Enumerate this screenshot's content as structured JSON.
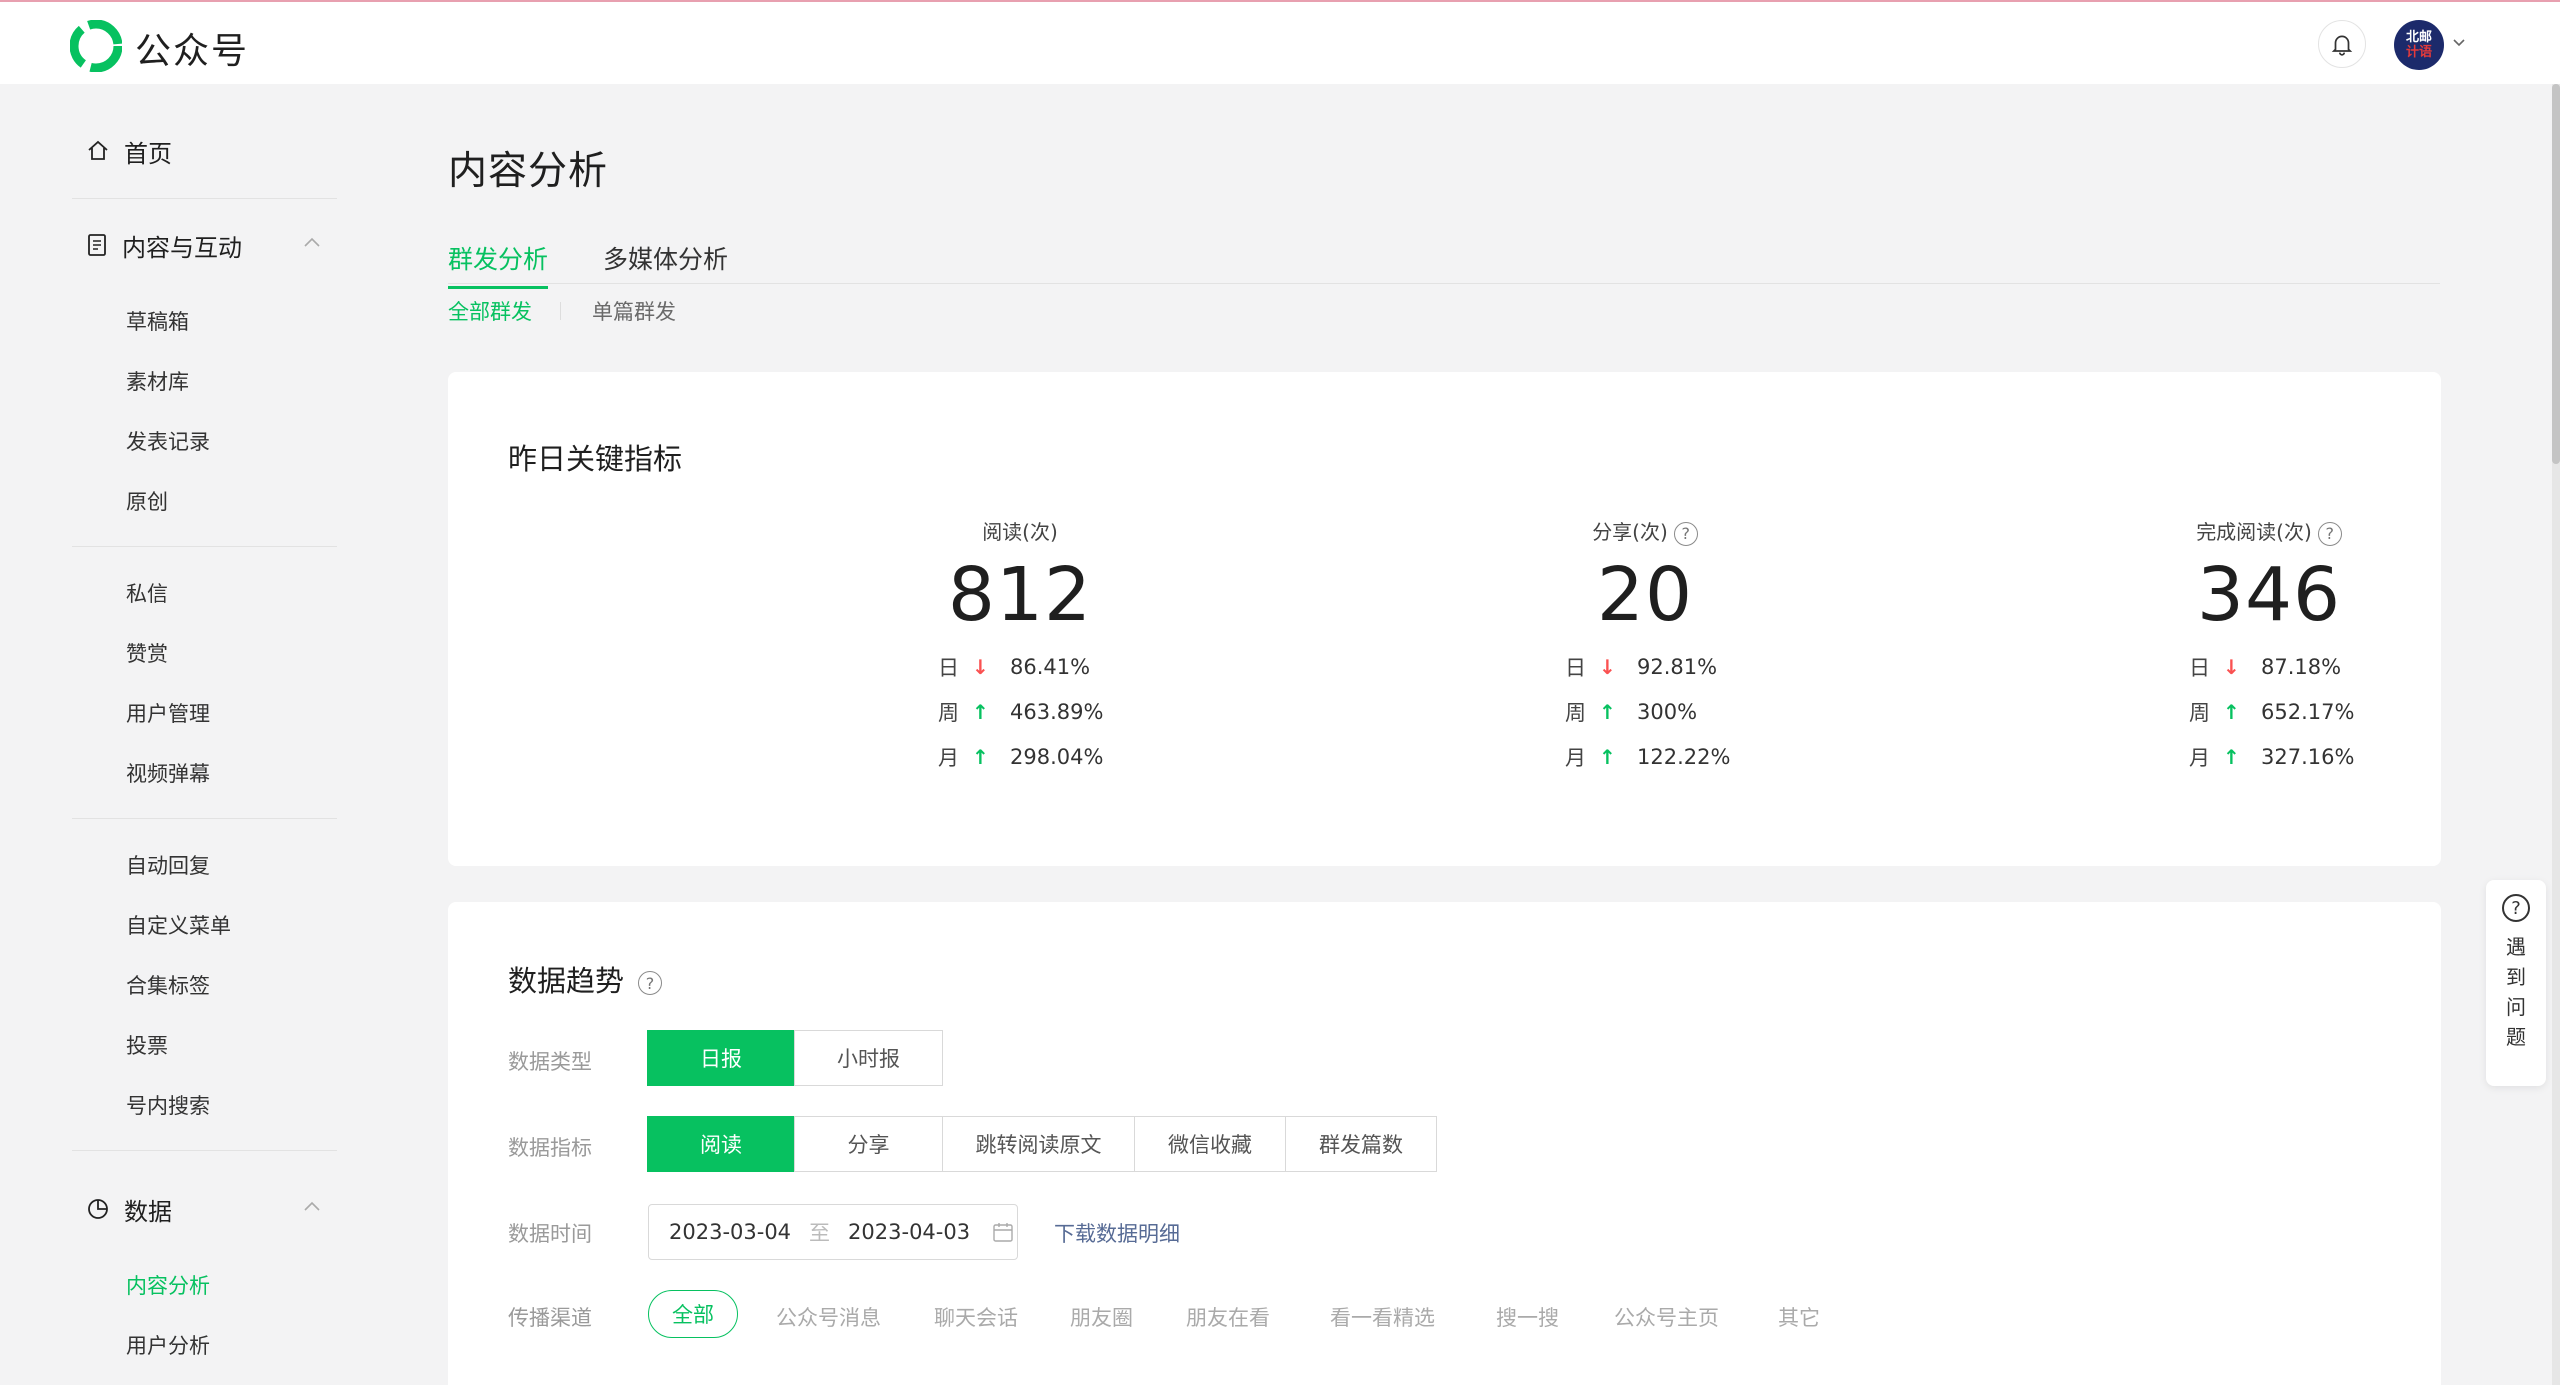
{
  "header": {
    "brand": "公众号",
    "avatar_text_top": "北邮",
    "avatar_text_bottom": "计语"
  },
  "sidebar": {
    "home": "首页",
    "content_section": "内容与互动",
    "content_items": [
      "草稿箱",
      "素材库",
      "发表记录",
      "原创"
    ],
    "interact_items": [
      "私信",
      "赞赏",
      "用户管理",
      "视频弹幕"
    ],
    "reply_items": [
      "自动回复",
      "自定义菜单",
      "合集标签",
      "投票",
      "号内搜索"
    ],
    "data_section": "数据",
    "data_items": [
      "内容分析",
      "用户分析"
    ],
    "active_item": "内容分析"
  },
  "page": {
    "title": "内容分析",
    "tabs": [
      "群发分析",
      "多媒体分析"
    ],
    "subtabs": [
      "全部群发",
      "单篇群发"
    ]
  },
  "key_metrics": {
    "title": "昨日关键指标",
    "metrics": [
      {
        "label": "阅读(次)",
        "value": "812",
        "day": "86.41%",
        "week": "463.89%",
        "month": "298.04%",
        "day_dir": "down",
        "week_dir": "up",
        "month_dir": "up"
      },
      {
        "label": "分享(次)",
        "value": "20",
        "day": "92.81%",
        "week": "300%",
        "month": "122.22%",
        "day_dir": "down",
        "week_dir": "up",
        "month_dir": "up"
      },
      {
        "label": "完成阅读(次)",
        "value": "346",
        "day": "87.18%",
        "week": "652.17%",
        "month": "327.16%",
        "day_dir": "down",
        "week_dir": "up",
        "month_dir": "up"
      }
    ],
    "period_labels": {
      "day": "日",
      "week": "周",
      "month": "月"
    }
  },
  "trend": {
    "title": "数据趋势",
    "type_label": "数据类型",
    "type_options": [
      "日报",
      "小时报"
    ],
    "metric_label": "数据指标",
    "metric_options": [
      "阅读",
      "分享",
      "跳转阅读原文",
      "微信收藏",
      "群发篇数"
    ],
    "time_label": "数据时间",
    "date_start": "2023-03-04",
    "date_to": "至",
    "date_end": "2023-04-03",
    "download": "下载数据明细",
    "channel_label": "传播渠道",
    "channels": [
      "全部",
      "公众号消息",
      "聊天会话",
      "朋友圈",
      "朋友在看",
      "看一看精选",
      "搜一搜",
      "公众号主页",
      "其它"
    ]
  },
  "float_help": {
    "text": "遇到问题"
  },
  "colors": {
    "accent": "#07c160",
    "down": "#fa5151",
    "link": "#576b95"
  }
}
